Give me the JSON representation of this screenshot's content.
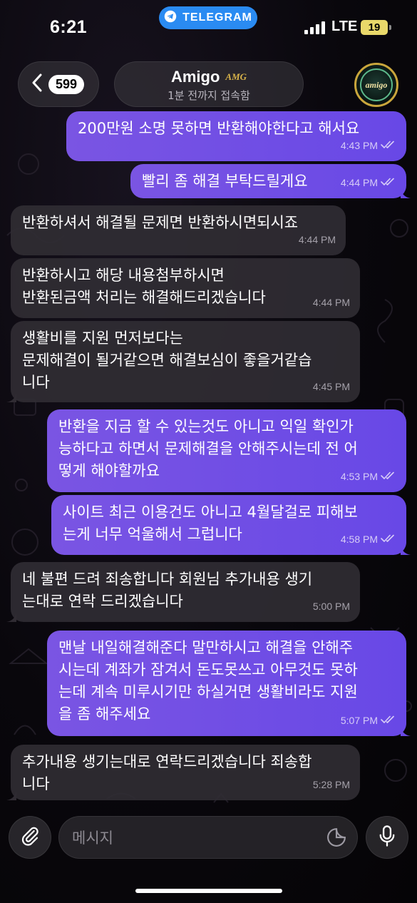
{
  "status_bar": {
    "time": "6:21",
    "app_pill": "TELEGRAM",
    "network": "LTE",
    "battery": "19"
  },
  "header": {
    "back_count": "599",
    "chat_name": "Amigo",
    "name_tag": "AMG",
    "last_seen": "1분 전까지 접속함",
    "avatar_text": "amigo"
  },
  "messages": [
    {
      "dir": "out",
      "text": "200만원 소명 못하면 반환해야한다고 해서요",
      "time": "4:43 PM"
    },
    {
      "dir": "out",
      "text": "빨리 좀 해결 부탁드릴게요",
      "time": "4:44 PM"
    },
    {
      "dir": "in",
      "text": "반환하셔서 해결될 문제면 반환하시면되시죠",
      "time": "4:44 PM"
    },
    {
      "dir": "in",
      "text": "반환하시고 해당 내용첨부하시면\n반환된금액 처리는 해결해드리겠습니다",
      "time": "4:44 PM"
    },
    {
      "dir": "in",
      "text": "생활비를 지원 먼저보다는\n문제해결이 될거같으면 해결보심이 좋을거같습\n니다",
      "time": "4:45 PM"
    },
    {
      "dir": "out",
      "text": "반환을 지금 할 수 있는것도 아니고 익일 확인가\n능하다고 하면서 문제해결을 안해주시는데 전 어\n떻게 해야할까요",
      "time": "4:53 PM"
    },
    {
      "dir": "out",
      "text": "사이트 최근 이용건도 아니고 4월달걸로 피해보\n는게 너무 억울해서 그럽니다",
      "time": "4:58 PM"
    },
    {
      "dir": "in",
      "text": "네 불편 드려 죄송합니다 회원님 추가내용 생기\n는대로 연락 드리겠습니다",
      "time": "5:00 PM"
    },
    {
      "dir": "out",
      "text": "맨날 내일해결해준다 말만하시고 해결을 안해주\n시는데 계좌가 잠겨서 돈도못쓰고 아무것도 못하\n는데 계속 미루시기만 하실거면 생활비라도 지원\n을 좀 해주세요",
      "time": "5:07 PM"
    },
    {
      "dir": "in",
      "text": "추가내용 생기는대로 연락드리겠습니다 죄송합\n니다",
      "time": "5:28 PM"
    }
  ],
  "input": {
    "placeholder": "메시지"
  },
  "icons": {
    "back": "chevron-left-icon",
    "telegram": "telegram-icon",
    "attach": "paperclip-icon",
    "sticker": "sticker-icon",
    "mic": "microphone-icon",
    "read": "double-check-icon"
  },
  "colors": {
    "outgoing_bubble": "#7054e6",
    "incoming_bubble": "#302c33",
    "telegram_pill": "#2a8bf2",
    "battery": "#e9d86a"
  }
}
